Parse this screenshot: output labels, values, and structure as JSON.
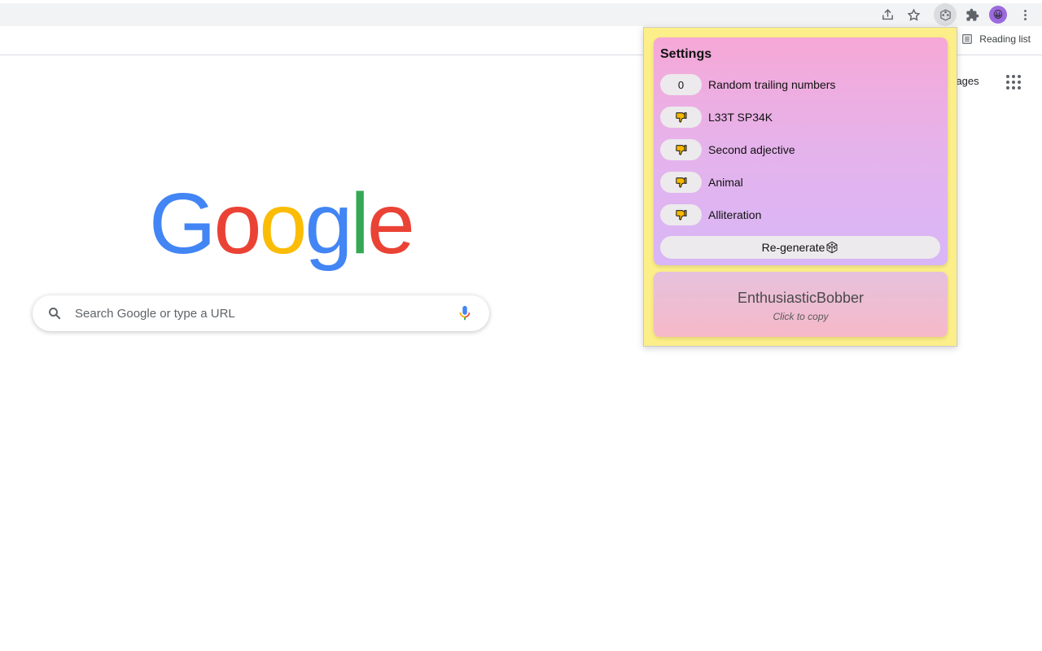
{
  "toolbar": {
    "share_icon": "share-icon",
    "bookmark_icon": "star-icon",
    "extension_icon": "dice-icon",
    "extensions_icon": "puzzle-icon",
    "profile_icon": "avatar",
    "menu_icon": "kebab-menu-icon"
  },
  "bookmarks": {
    "reading_list": "Reading list"
  },
  "google": {
    "images_link": "Images",
    "logo": [
      "G",
      "o",
      "o",
      "g",
      "l",
      "e"
    ],
    "search": {
      "placeholder": "Search Google or type a URL",
      "value": ""
    }
  },
  "popup": {
    "settings_title": "Settings",
    "options": [
      {
        "value": "0",
        "icon": "",
        "label": "Random trailing numbers"
      },
      {
        "value": "",
        "icon": "thumbs-down-icon",
        "label": "L33T SP34K"
      },
      {
        "value": "",
        "icon": "thumbs-down-icon",
        "label": "Second adjective"
      },
      {
        "value": "",
        "icon": "thumbs-down-icon",
        "label": "Animal"
      },
      {
        "value": "",
        "icon": "thumbs-down-icon",
        "label": "Alliteration"
      }
    ],
    "regenerate_label": "Re-generate",
    "generated_name": "EnthusiasticBobber",
    "copy_hint": "Click to copy"
  },
  "colors": {
    "popup_bg": "#fcee88",
    "settings_gradient_top": "#f6a8d6",
    "settings_gradient_bottom": "#d8b6f7",
    "name_gradient_top": "#e6c1dc",
    "name_gradient_bottom": "#f6b9c9",
    "thumb_color": "#f9b800"
  }
}
